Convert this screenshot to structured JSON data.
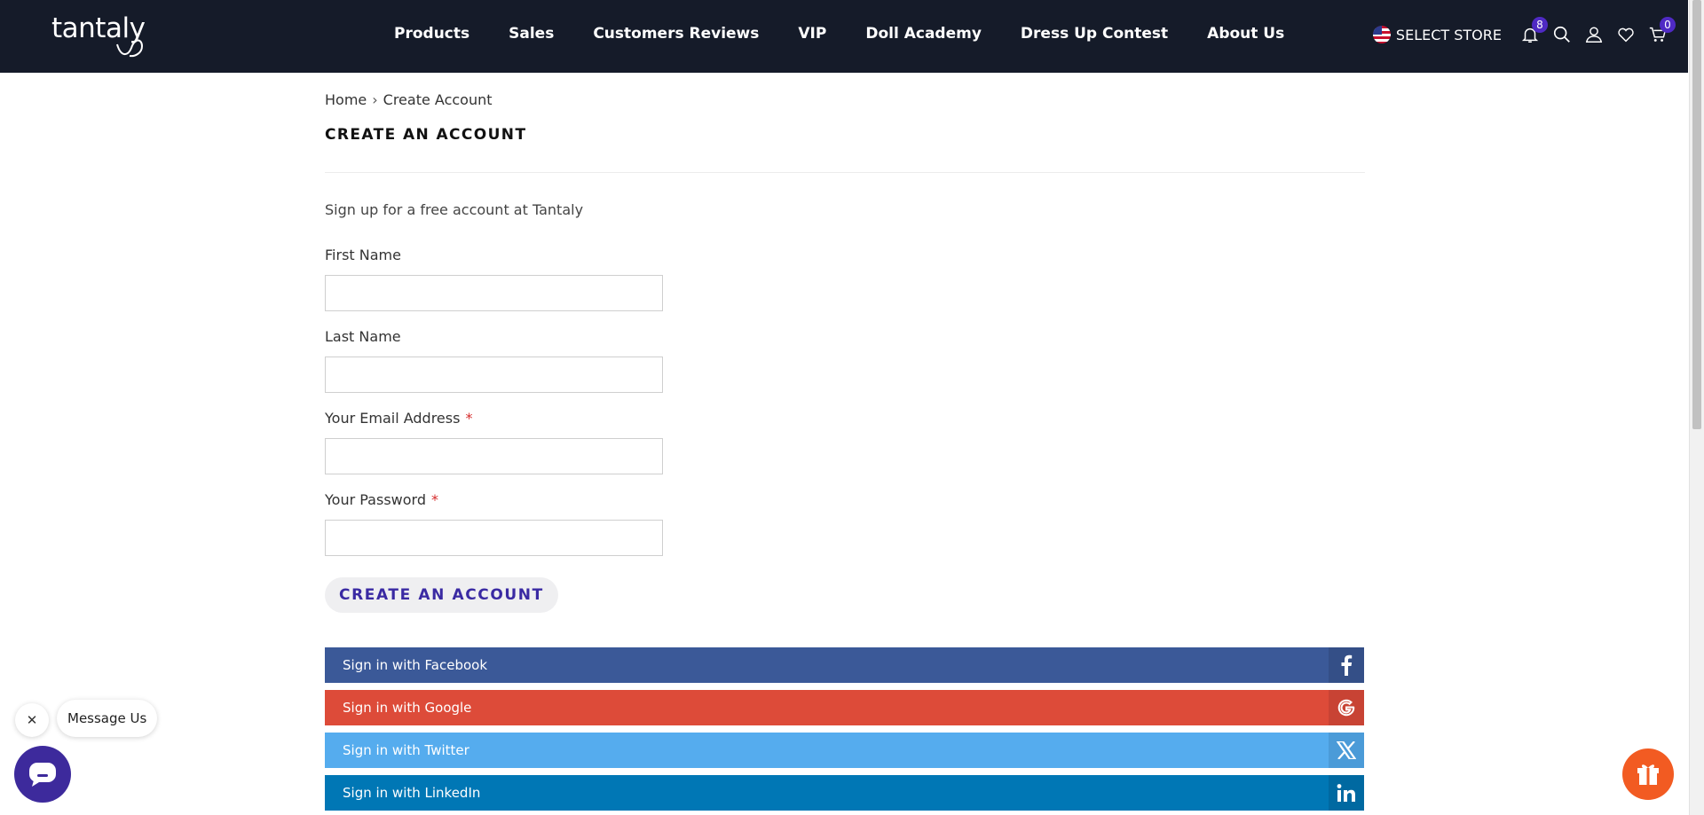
{
  "brand": {
    "logo_text": "tantaly"
  },
  "nav": {
    "items": [
      {
        "label": "Products"
      },
      {
        "label": "Sales"
      },
      {
        "label": "Customers Reviews"
      },
      {
        "label": "VIP"
      },
      {
        "label": "Doll Academy"
      },
      {
        "label": "Dress Up Contest"
      },
      {
        "label": "About Us"
      }
    ]
  },
  "header_right": {
    "store_label": "SELECT STORE",
    "notifications_count": "8",
    "cart_count": "0",
    "icons": [
      "us-flag-icon",
      "bell-icon",
      "search-icon",
      "user-icon",
      "heart-icon",
      "cart-icon"
    ]
  },
  "breadcrumb": {
    "home": "Home",
    "current": "Create Account"
  },
  "page": {
    "title": "CREATE AN ACCOUNT",
    "intro": "Sign up for a free account at Tantaly"
  },
  "form": {
    "first_name": {
      "label": "First Name",
      "value": ""
    },
    "last_name": {
      "label": "Last Name",
      "value": ""
    },
    "email": {
      "label": "Your Email Address",
      "required_mark": "*",
      "value": ""
    },
    "password": {
      "label": "Your Password",
      "required_mark": "*",
      "value": ""
    },
    "submit_label": "CREATE AN ACCOUNT"
  },
  "social": [
    {
      "label": "Sign in with Facebook",
      "icon": "facebook-icon",
      "color": "#3b5998"
    },
    {
      "label": "Sign in with Google",
      "icon": "google-icon",
      "color": "#dd4b39"
    },
    {
      "label": "Sign in with Twitter",
      "icon": "x-icon",
      "color": "#55acee"
    },
    {
      "label": "Sign in with LinkedIn",
      "icon": "linkedin-icon",
      "color": "#0077b5"
    }
  ],
  "chat": {
    "message_label": "Message Us",
    "icons": [
      "close-icon",
      "chat-icon",
      "gift-icon"
    ]
  },
  "colors": {
    "header_bg": "#151b29",
    "accent": "#3d2a9c",
    "gift": "#f25b22"
  }
}
